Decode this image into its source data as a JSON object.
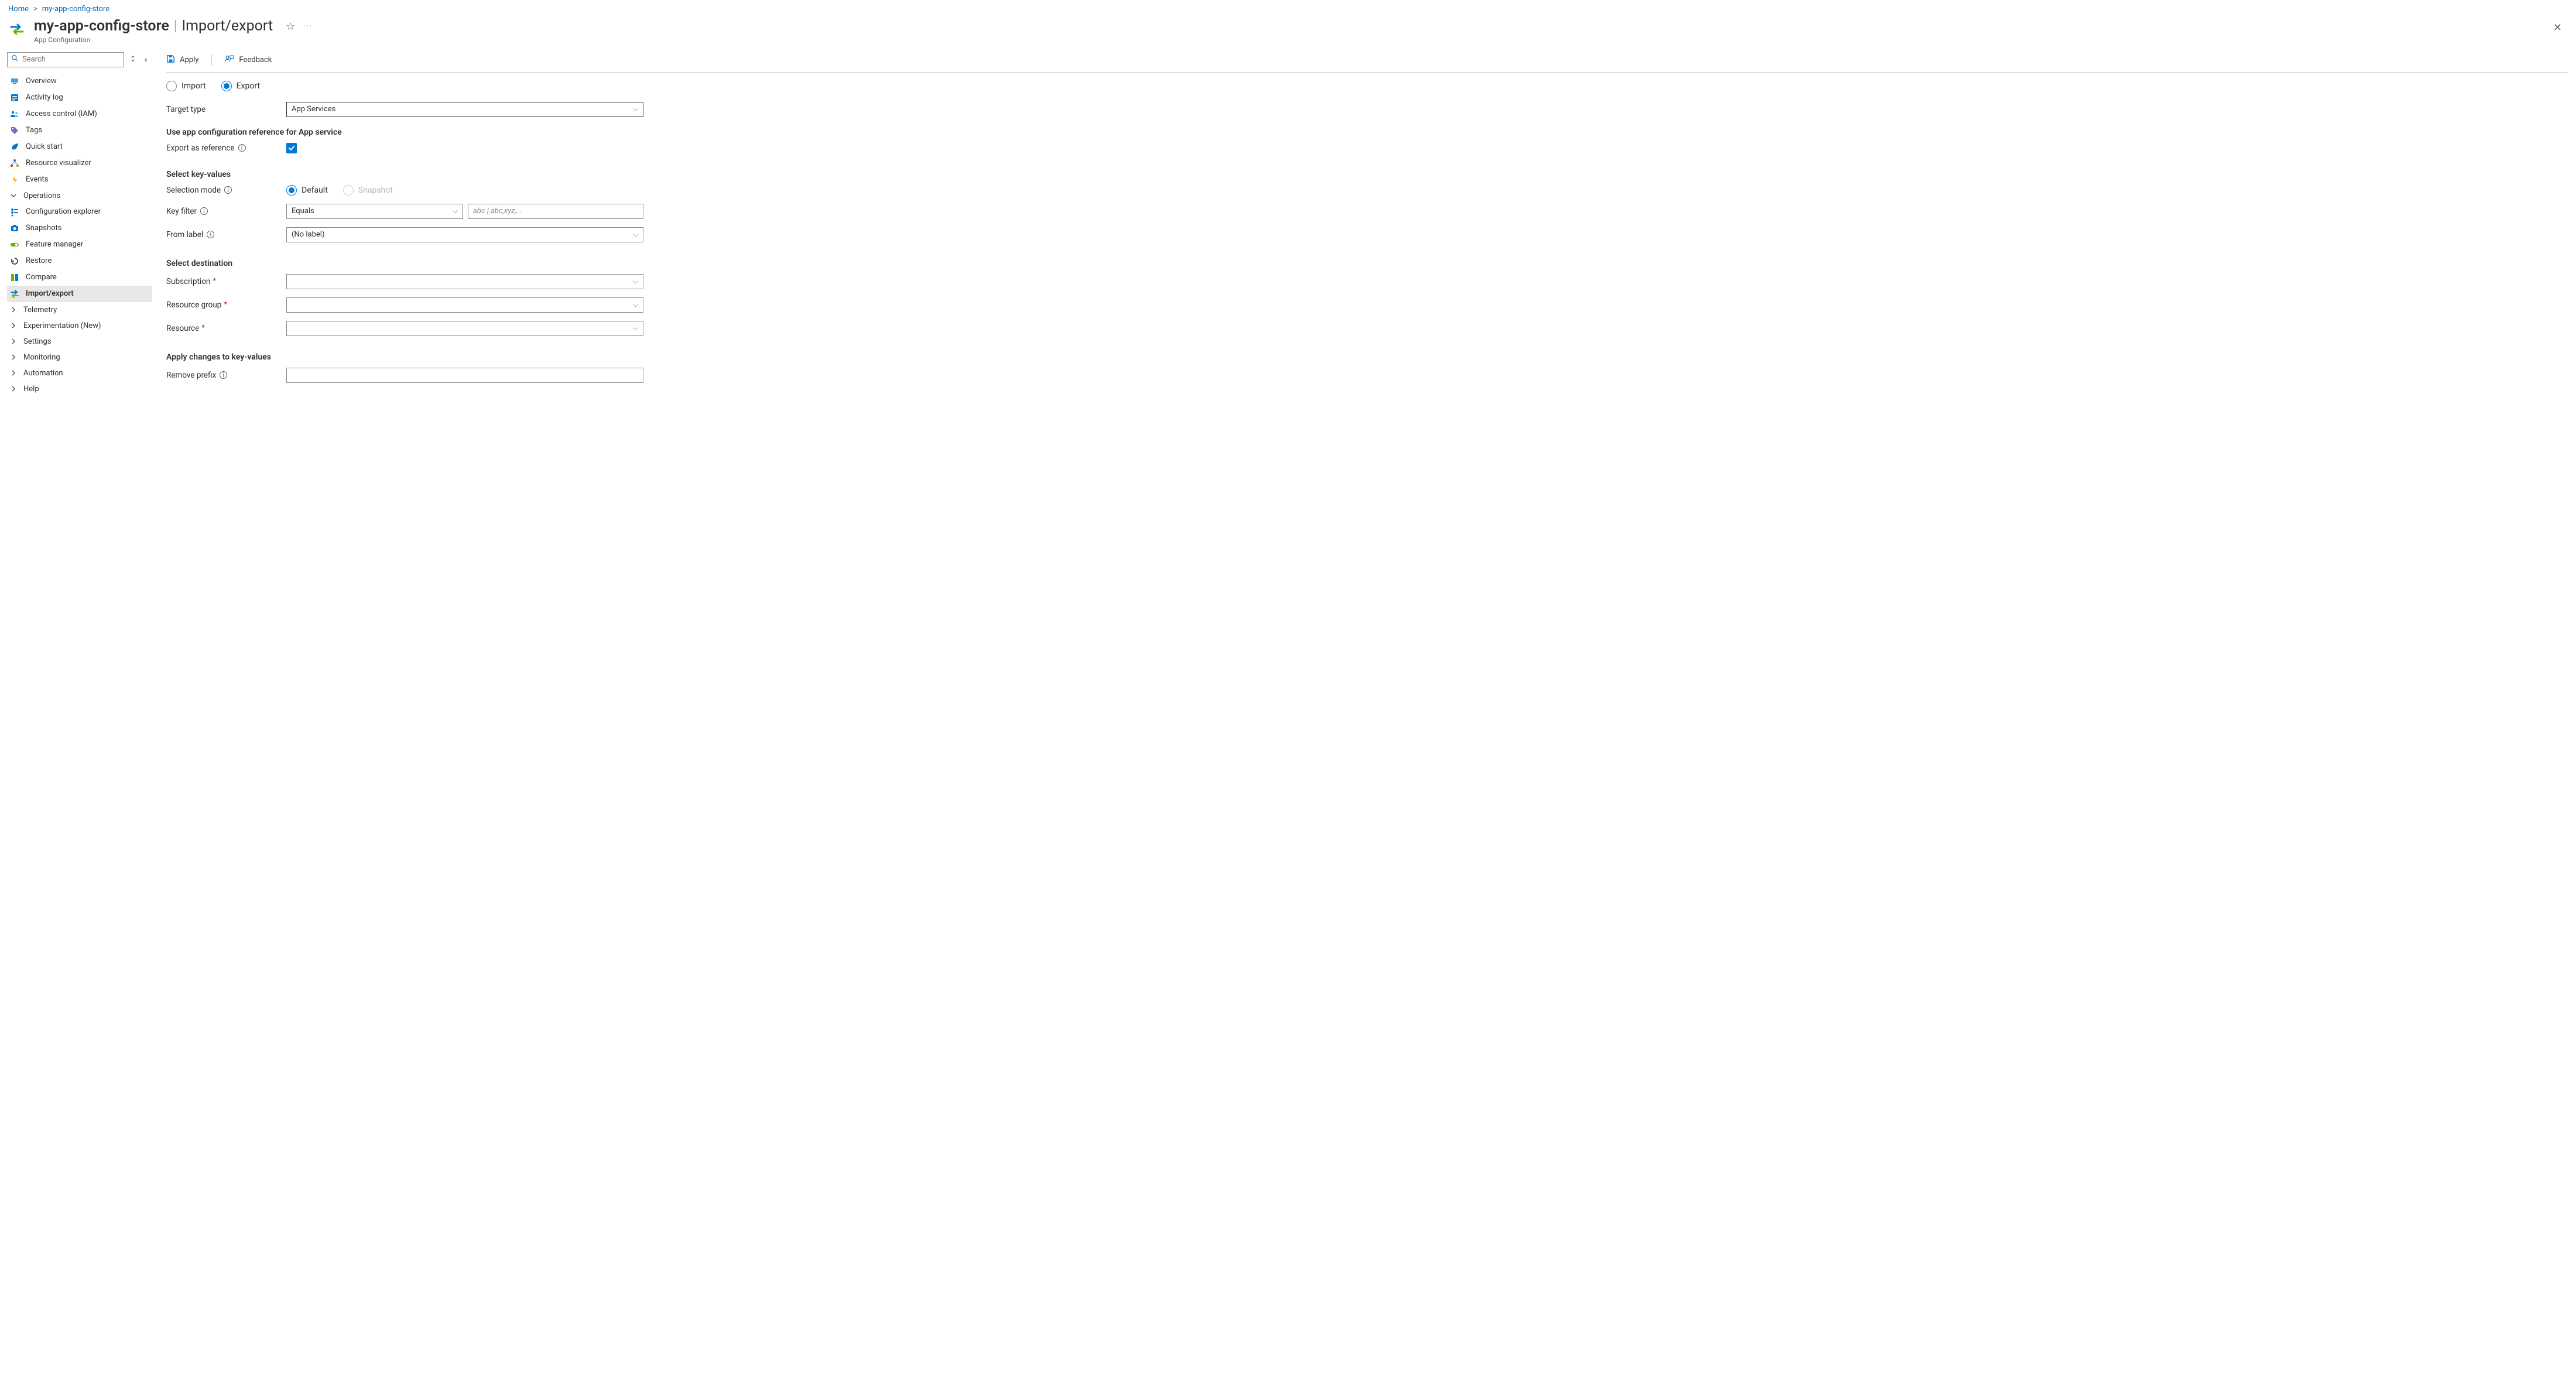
{
  "breadcrumb": {
    "home": "Home",
    "resource": "my-app-config-store"
  },
  "header": {
    "resourceName": "my-app-config-store",
    "pageName": "Import/export",
    "resourceType": "App Configuration"
  },
  "sidebar": {
    "searchPlaceholder": "Search",
    "items": {
      "overview": "Overview",
      "activityLog": "Activity log",
      "accessControl": "Access control (IAM)",
      "tags": "Tags",
      "quickStart": "Quick start",
      "resourceVisualizer": "Resource visualizer",
      "events": "Events"
    },
    "groups": {
      "operations": "Operations",
      "telemetry": "Telemetry",
      "experimentation": "Experimentation (New)",
      "settings": "Settings",
      "monitoring": "Monitoring",
      "automation": "Automation",
      "help": "Help"
    },
    "operationsItems": {
      "configExplorer": "Configuration explorer",
      "snapshots": "Snapshots",
      "featureManager": "Feature manager",
      "restore": "Restore",
      "compare": "Compare",
      "importExport": "Import/export"
    }
  },
  "toolbar": {
    "apply": "Apply",
    "feedback": "Feedback"
  },
  "mode": {
    "import": "Import",
    "export": "Export"
  },
  "form": {
    "targetTypeLabel": "Target type",
    "targetTypeValue": "App Services",
    "refSection": "Use app configuration reference for App service",
    "exportAsRefLabel": "Export as reference",
    "selectKVSection": "Select key-values",
    "selectionModeLabel": "Selection mode",
    "selectionModeDefault": "Default",
    "selectionModeSnapshot": "Snapshot",
    "keyFilterLabel": "Key filter",
    "keyFilterOp": "Equals",
    "keyFilterPlaceholder": "abc | abc,xyz,...",
    "fromLabelLabel": "From label",
    "fromLabelValue": "(No label)",
    "destSection": "Select destination",
    "subscriptionLabel": "Subscription",
    "resourceGroupLabel": "Resource group",
    "resourceLabel": "Resource",
    "applyChangesSection": "Apply changes to key-values",
    "removePrefixLabel": "Remove prefix"
  }
}
